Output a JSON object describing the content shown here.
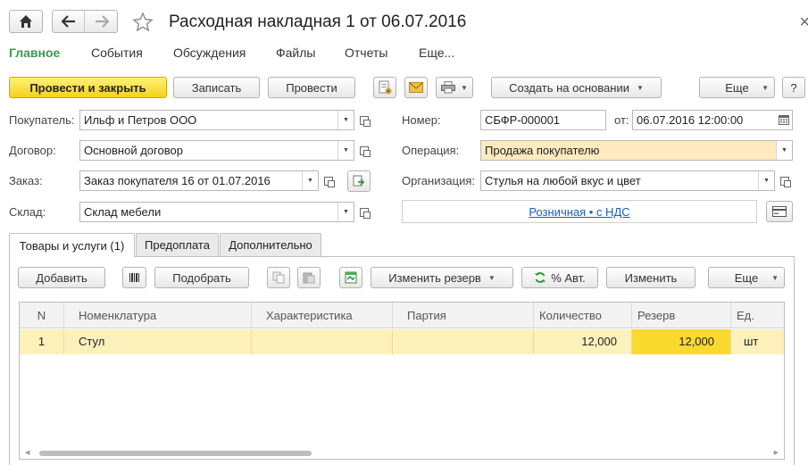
{
  "window": {
    "title": "Расходная накладная 1 от 06.07.2016"
  },
  "sections": [
    {
      "label": "Главное",
      "active": true
    },
    {
      "label": "События"
    },
    {
      "label": "Обсуждения"
    },
    {
      "label": "Файлы"
    },
    {
      "label": "Отчеты"
    },
    {
      "label": "Еще..."
    }
  ],
  "toolbar": {
    "post_and_close": "Провести и закрыть",
    "save": "Записать",
    "post": "Провести",
    "create_based_on": "Создать на основании",
    "more": "Еще",
    "help": "?"
  },
  "form": {
    "buyer_label": "Покупатель:",
    "buyer_value": "Ильф и Петров ООО",
    "contract_label": "Договор:",
    "contract_value": "Основной договор",
    "order_label": "Заказ:",
    "order_value": "Заказ покупателя 16 от 01.07.2016",
    "warehouse_label": "Склад:",
    "warehouse_value": "Склад мебели",
    "number_label": "Номер:",
    "number_value": "СБФР-000001",
    "date_label": "от:",
    "date_value": "06.07.2016 12:00:00",
    "operation_label": "Операция:",
    "operation_value": "Продажа покупателю",
    "organization_label": "Организация:",
    "organization_value": "Стулья на любой вкус и цвет",
    "price_link": "Розничная • с НДС"
  },
  "tabs": [
    {
      "label": "Товары и услуги (1)",
      "active": true
    },
    {
      "label": "Предоплата"
    },
    {
      "label": "Дополнительно"
    }
  ],
  "table_toolbar": {
    "add": "Добавить",
    "pick": "Подобрать",
    "change_reserve": "Изменить резерв",
    "auto_percent": "% Авт.",
    "change": "Изменить",
    "more": "Еще"
  },
  "table": {
    "columns": [
      "N",
      "Номенклатура",
      "Характеристика",
      "Партия",
      "Количество",
      "Резерв",
      "Ед."
    ],
    "rows": [
      {
        "n": "1",
        "item": "Стул",
        "characteristic": "",
        "batch": "",
        "quantity": "12,000",
        "reserve": "12,000",
        "unit": "шт"
      }
    ]
  },
  "colors": {
    "primary_button": "#f5d73a",
    "active_section": "#3a9a4c",
    "highlight_field": "#fdeabe",
    "selected_row": "#fcf0bb",
    "selected_cell": "#f9d92e",
    "link": "#1b5fbf"
  }
}
